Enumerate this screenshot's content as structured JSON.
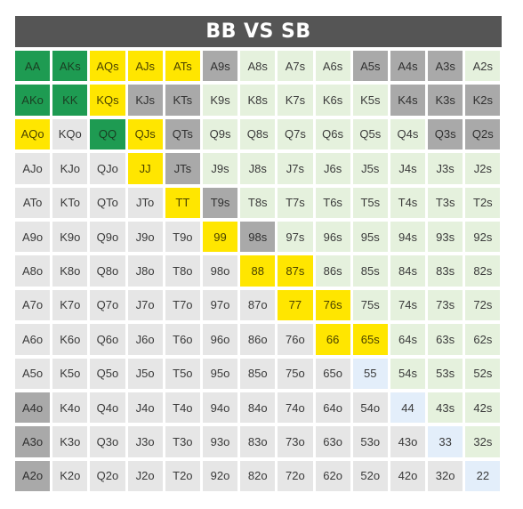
{
  "title": "BB VS SB",
  "colors": {
    "raise": "#1e9b52",
    "call": "#ffe600",
    "mixed": "#a9a9a9",
    "fold_suited": "#e5f1dd",
    "fold_offsuit": "#e6e6e6",
    "fold_pair": "#e3eefa"
  },
  "rows": [
    [
      [
        "AA",
        "green"
      ],
      [
        "AKs",
        "green"
      ],
      [
        "AQs",
        "yellow"
      ],
      [
        "AJs",
        "yellow"
      ],
      [
        "ATs",
        "yellow"
      ],
      [
        "A9s",
        "gray"
      ],
      [
        "A8s",
        "suited"
      ],
      [
        "A7s",
        "suited"
      ],
      [
        "A6s",
        "suited"
      ],
      [
        "A5s",
        "gray"
      ],
      [
        "A4s",
        "gray"
      ],
      [
        "A3s",
        "gray"
      ],
      [
        "A2s",
        "suited"
      ]
    ],
    [
      [
        "AKo",
        "green"
      ],
      [
        "KK",
        "green"
      ],
      [
        "KQs",
        "yellow"
      ],
      [
        "KJs",
        "gray"
      ],
      [
        "KTs",
        "gray"
      ],
      [
        "K9s",
        "suited"
      ],
      [
        "K8s",
        "suited"
      ],
      [
        "K7s",
        "suited"
      ],
      [
        "K6s",
        "suited"
      ],
      [
        "K5s",
        "suited"
      ],
      [
        "K4s",
        "gray"
      ],
      [
        "K3s",
        "gray"
      ],
      [
        "K2s",
        "gray"
      ]
    ],
    [
      [
        "AQo",
        "yellow"
      ],
      [
        "KQo",
        "off"
      ],
      [
        "QQ",
        "green"
      ],
      [
        "QJs",
        "yellow"
      ],
      [
        "QTs",
        "gray"
      ],
      [
        "Q9s",
        "suited"
      ],
      [
        "Q8s",
        "suited"
      ],
      [
        "Q7s",
        "suited"
      ],
      [
        "Q6s",
        "suited"
      ],
      [
        "Q5s",
        "suited"
      ],
      [
        "Q4s",
        "suited"
      ],
      [
        "Q3s",
        "gray"
      ],
      [
        "Q2s",
        "gray"
      ]
    ],
    [
      [
        "AJo",
        "off"
      ],
      [
        "KJo",
        "off"
      ],
      [
        "QJo",
        "off"
      ],
      [
        "JJ",
        "yellow"
      ],
      [
        "JTs",
        "gray"
      ],
      [
        "J9s",
        "suited"
      ],
      [
        "J8s",
        "suited"
      ],
      [
        "J7s",
        "suited"
      ],
      [
        "J6s",
        "suited"
      ],
      [
        "J5s",
        "suited"
      ],
      [
        "J4s",
        "suited"
      ],
      [
        "J3s",
        "suited"
      ],
      [
        "J2s",
        "suited"
      ]
    ],
    [
      [
        "ATo",
        "off"
      ],
      [
        "KTo",
        "off"
      ],
      [
        "QTo",
        "off"
      ],
      [
        "JTo",
        "off"
      ],
      [
        "TT",
        "yellow"
      ],
      [
        "T9s",
        "gray"
      ],
      [
        "T8s",
        "suited"
      ],
      [
        "T7s",
        "suited"
      ],
      [
        "T6s",
        "suited"
      ],
      [
        "T5s",
        "suited"
      ],
      [
        "T4s",
        "suited"
      ],
      [
        "T3s",
        "suited"
      ],
      [
        "T2s",
        "suited"
      ]
    ],
    [
      [
        "A9o",
        "off"
      ],
      [
        "K9o",
        "off"
      ],
      [
        "Q9o",
        "off"
      ],
      [
        "J9o",
        "off"
      ],
      [
        "T9o",
        "off"
      ],
      [
        "99",
        "yellow"
      ],
      [
        "98s",
        "gray"
      ],
      [
        "97s",
        "suited"
      ],
      [
        "96s",
        "suited"
      ],
      [
        "95s",
        "suited"
      ],
      [
        "94s",
        "suited"
      ],
      [
        "93s",
        "suited"
      ],
      [
        "92s",
        "suited"
      ]
    ],
    [
      [
        "A8o",
        "off"
      ],
      [
        "K8o",
        "off"
      ],
      [
        "Q8o",
        "off"
      ],
      [
        "J8o",
        "off"
      ],
      [
        "T8o",
        "off"
      ],
      [
        "98o",
        "off"
      ],
      [
        "88",
        "yellow"
      ],
      [
        "87s",
        "yellow"
      ],
      [
        "86s",
        "suited"
      ],
      [
        "85s",
        "suited"
      ],
      [
        "84s",
        "suited"
      ],
      [
        "83s",
        "suited"
      ],
      [
        "82s",
        "suited"
      ]
    ],
    [
      [
        "A7o",
        "off"
      ],
      [
        "K7o",
        "off"
      ],
      [
        "Q7o",
        "off"
      ],
      [
        "J7o",
        "off"
      ],
      [
        "T7o",
        "off"
      ],
      [
        "97o",
        "off"
      ],
      [
        "87o",
        "off"
      ],
      [
        "77",
        "yellow"
      ],
      [
        "76s",
        "yellow"
      ],
      [
        "75s",
        "suited"
      ],
      [
        "74s",
        "suited"
      ],
      [
        "73s",
        "suited"
      ],
      [
        "72s",
        "suited"
      ]
    ],
    [
      [
        "A6o",
        "off"
      ],
      [
        "K6o",
        "off"
      ],
      [
        "Q6o",
        "off"
      ],
      [
        "J6o",
        "off"
      ],
      [
        "T6o",
        "off"
      ],
      [
        "96o",
        "off"
      ],
      [
        "86o",
        "off"
      ],
      [
        "76o",
        "off"
      ],
      [
        "66",
        "yellow"
      ],
      [
        "65s",
        "yellow"
      ],
      [
        "64s",
        "suited"
      ],
      [
        "63s",
        "suited"
      ],
      [
        "62s",
        "suited"
      ]
    ],
    [
      [
        "A5o",
        "off"
      ],
      [
        "K5o",
        "off"
      ],
      [
        "Q5o",
        "off"
      ],
      [
        "J5o",
        "off"
      ],
      [
        "T5o",
        "off"
      ],
      [
        "95o",
        "off"
      ],
      [
        "85o",
        "off"
      ],
      [
        "75o",
        "off"
      ],
      [
        "65o",
        "off"
      ],
      [
        "55",
        "pair"
      ],
      [
        "54s",
        "suited"
      ],
      [
        "53s",
        "suited"
      ],
      [
        "52s",
        "suited"
      ]
    ],
    [
      [
        "A4o",
        "gray"
      ],
      [
        "K4o",
        "off"
      ],
      [
        "Q4o",
        "off"
      ],
      [
        "J4o",
        "off"
      ],
      [
        "T4o",
        "off"
      ],
      [
        "94o",
        "off"
      ],
      [
        "84o",
        "off"
      ],
      [
        "74o",
        "off"
      ],
      [
        "64o",
        "off"
      ],
      [
        "54o",
        "off"
      ],
      [
        "44",
        "pair"
      ],
      [
        "43s",
        "suited"
      ],
      [
        "42s",
        "suited"
      ]
    ],
    [
      [
        "A3o",
        "gray"
      ],
      [
        "K3o",
        "off"
      ],
      [
        "Q3o",
        "off"
      ],
      [
        "J3o",
        "off"
      ],
      [
        "T3o",
        "off"
      ],
      [
        "93o",
        "off"
      ],
      [
        "83o",
        "off"
      ],
      [
        "73o",
        "off"
      ],
      [
        "63o",
        "off"
      ],
      [
        "53o",
        "off"
      ],
      [
        "43o",
        "off"
      ],
      [
        "33",
        "pair"
      ],
      [
        "32s",
        "suited"
      ]
    ],
    [
      [
        "A2o",
        "gray"
      ],
      [
        "K2o",
        "off"
      ],
      [
        "Q2o",
        "off"
      ],
      [
        "J2o",
        "off"
      ],
      [
        "T2o",
        "off"
      ],
      [
        "92o",
        "off"
      ],
      [
        "82o",
        "off"
      ],
      [
        "72o",
        "off"
      ],
      [
        "62o",
        "off"
      ],
      [
        "52o",
        "off"
      ],
      [
        "42o",
        "off"
      ],
      [
        "32o",
        "off"
      ],
      [
        "22",
        "pair"
      ]
    ]
  ]
}
